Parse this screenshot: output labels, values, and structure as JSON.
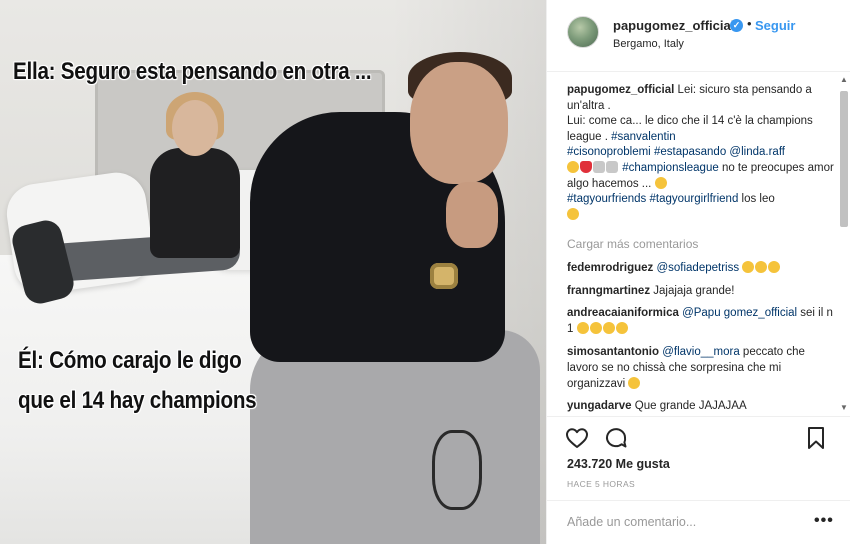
{
  "photo": {
    "meme_top": "Ella: Seguro esta pensando en otra ...",
    "meme_bottom_line1": "Él: Cómo carajo le digo",
    "meme_bottom_line2": "que el 14 hay champions"
  },
  "header": {
    "username": "papugomez_official",
    "verified": "✓",
    "separator": "•",
    "follow_label": "Seguir",
    "location": "Bergamo, Italy"
  },
  "caption": {
    "username": "papugomez_official",
    "text1": " Lei: sicuro sta pensando a un'altra .",
    "text2": "Lui: come ca... le dico che il 14 c'è la champions league . ",
    "tag_sanvalentin": "#sanvalentin",
    "tag_cisono": "#cisonoproblemi",
    "tag_estapasando": "#estapasando",
    "mention_linda": "@linda.raff",
    "tag_champions": "#championsleague",
    "text3": " no te preocupes amor algo hacemos ... ",
    "tag_tagyourfriends": "#tagyourfriends",
    "tag_girlfriend": "#tagyourgirlfriend",
    "text4": " los leo"
  },
  "load_more": "Cargar más comentarios",
  "comments": [
    {
      "user": "fedemrodriguez",
      "mention": "@sofiadepetriss",
      "text": ""
    },
    {
      "user": "franngmartinez",
      "mention": "",
      "text": "Jajajaja grande!"
    },
    {
      "user": "andreacaianiformica",
      "mention": "@Papu gomez_official",
      "text": " sei il n 1 "
    },
    {
      "user": "simosantantonio",
      "mention": "@flavio__mora",
      "text": " peccato che lavoro se no chissà che sorpresina che mi organizzavi "
    },
    {
      "user": "yungadarve",
      "mention": "",
      "text": "Que grande JAJAJAA"
    }
  ],
  "actions": {
    "likes": "243.720 Me gusta",
    "time": "HACE 5 HORAS"
  },
  "add_comment": {
    "placeholder": "Añade un comentario...",
    "more": "•••"
  },
  "colors": {
    "accent": "#3897f0",
    "link": "#003569",
    "muted": "#999999",
    "text": "#262626"
  }
}
